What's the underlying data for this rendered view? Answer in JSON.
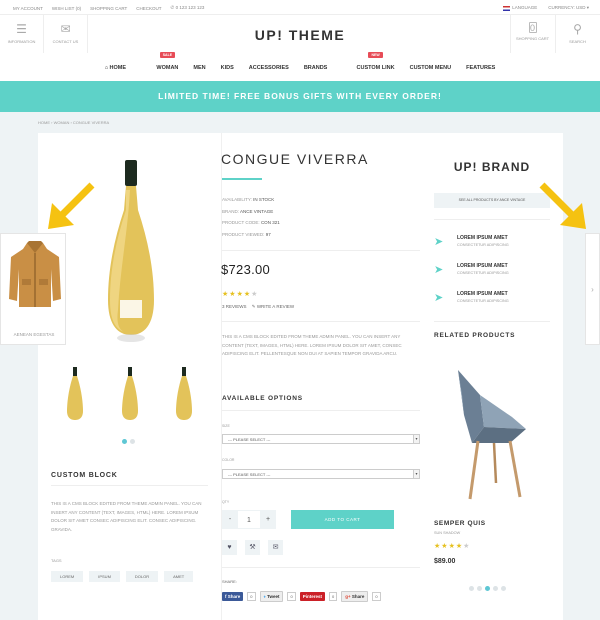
{
  "topbar": {
    "my_account": "MY ACCOUNT",
    "wishlist": "WISH LIST (0)",
    "shopping_cart": "SHOPPING CART",
    "checkout": "CHECKOUT",
    "phone": "0 123 123 123",
    "language": "LANGUAGE",
    "currency": "CURRENCY: USD"
  },
  "header": {
    "information": "INFORMATION",
    "contact_us": "CONTACT US",
    "logo": "UP! THEME",
    "cart_count": "0",
    "shopping_cart": "SHOPPING CART",
    "search": "SEARCH"
  },
  "nav": {
    "items": [
      "HOME",
      "WOMAN",
      "MEN",
      "KIDS",
      "ACCESSORIES",
      "BRANDS",
      "CUSTOM LINK",
      "CUSTOM MENU",
      "FEATURES"
    ],
    "badge_sale": "SALE",
    "badge_new": "NEW"
  },
  "promo": "LIMITED TIME! FREE BONUS GIFTS WITH EVERY ORDER!",
  "breadcrumb": [
    "HOME",
    "WOMAN",
    "CONGUE VIVERRA"
  ],
  "product": {
    "title": "CONGUE VIVERRA",
    "availability_label": "AVAILABILITY:",
    "availability": "IN STOCK",
    "brand_label": "BRAND:",
    "brand": "ANCE VINTAGE",
    "code_label": "PRODUCT CODE:",
    "code": "CON 321",
    "viewed_label": "PRODUCT VIEWED:",
    "viewed": "97",
    "price": "$723.00",
    "rating": 4,
    "reviews": "3 REVIEWS",
    "write_review": "WRITE A REVIEW",
    "description": "THIS IS A CMS BLOCK EDITED FROM THEME ADMIN PANEL. YOU CAN INSERT ANY CONTENT (TEXT, IMAGES, HTML) HERE. LOREM IPSUM DOLOR SIT AMET, CONSEC ADIPISCING ELIT. PELLENTESQUE NON DUI AT SAPIEN TEMPOR GRAVIDA ARCU."
  },
  "options": {
    "title": "AVAILABLE OPTIONS",
    "size_label": "SIZE",
    "size_value": "--- PLEASE SELECT ---",
    "color_label": "COLOR",
    "color_value": "--- PLEASE SELECT ---",
    "qty_label": "QTY",
    "qty_minus": "-",
    "qty_value": "1",
    "qty_plus": "+",
    "add_to_cart": "ADD TO CART",
    "share_label": "SHARE:"
  },
  "social": {
    "facebook": "Share",
    "facebook_count": "0",
    "twitter": "Tweet",
    "twitter_count": "0",
    "pinterest": "Pinterest",
    "pinterest_count": "0",
    "google": "Share",
    "google_count": "0"
  },
  "custom_block": {
    "title": "CUSTOM BLOCK",
    "text": "THIS IS A CMS BLOCK EDITED FROM THEME ADMIN PANEL. YOU CAN INSERT ANY CONTENT (TEXT, IMAGES, HTML) HERE. LOREM IPSUM DOLOR SIT AMET CONSEC ADIPISCING ELIT. CONSEC ADIPISCING. GRAVIDA.",
    "tags_label": "TAGS",
    "tags": [
      "LOREM",
      "IPSUM",
      "DOLOR",
      "AMET"
    ]
  },
  "brand_panel": {
    "logo": "UP! BRAND",
    "see_all": "SEE ALL PRODUCTS BY ANCE VINTAGE",
    "features": [
      {
        "title": "LOREM IPSUM AMET",
        "sub": "CONSECTETUR ADIPISCING"
      },
      {
        "title": "LOREM IPSUM AMET",
        "sub": "CONSECTETUR ADIPISCING"
      },
      {
        "title": "LOREM IPSUM AMET",
        "sub": "CONSECTETUR ADIPISCING"
      }
    ]
  },
  "related": {
    "title": "RELATED PRODUCTS",
    "name": "SEMPER QUIS",
    "brand": "SUN SHADOW",
    "rating": 4,
    "price": "$89.00"
  },
  "side_product": {
    "name": "AENEAN EGESTAS"
  },
  "colors": {
    "accent": "#5ed2c8",
    "star": "#e6c121",
    "arrow": "#f5c211",
    "facebook": "#3b5998",
    "pinterest": "#cb2027"
  }
}
